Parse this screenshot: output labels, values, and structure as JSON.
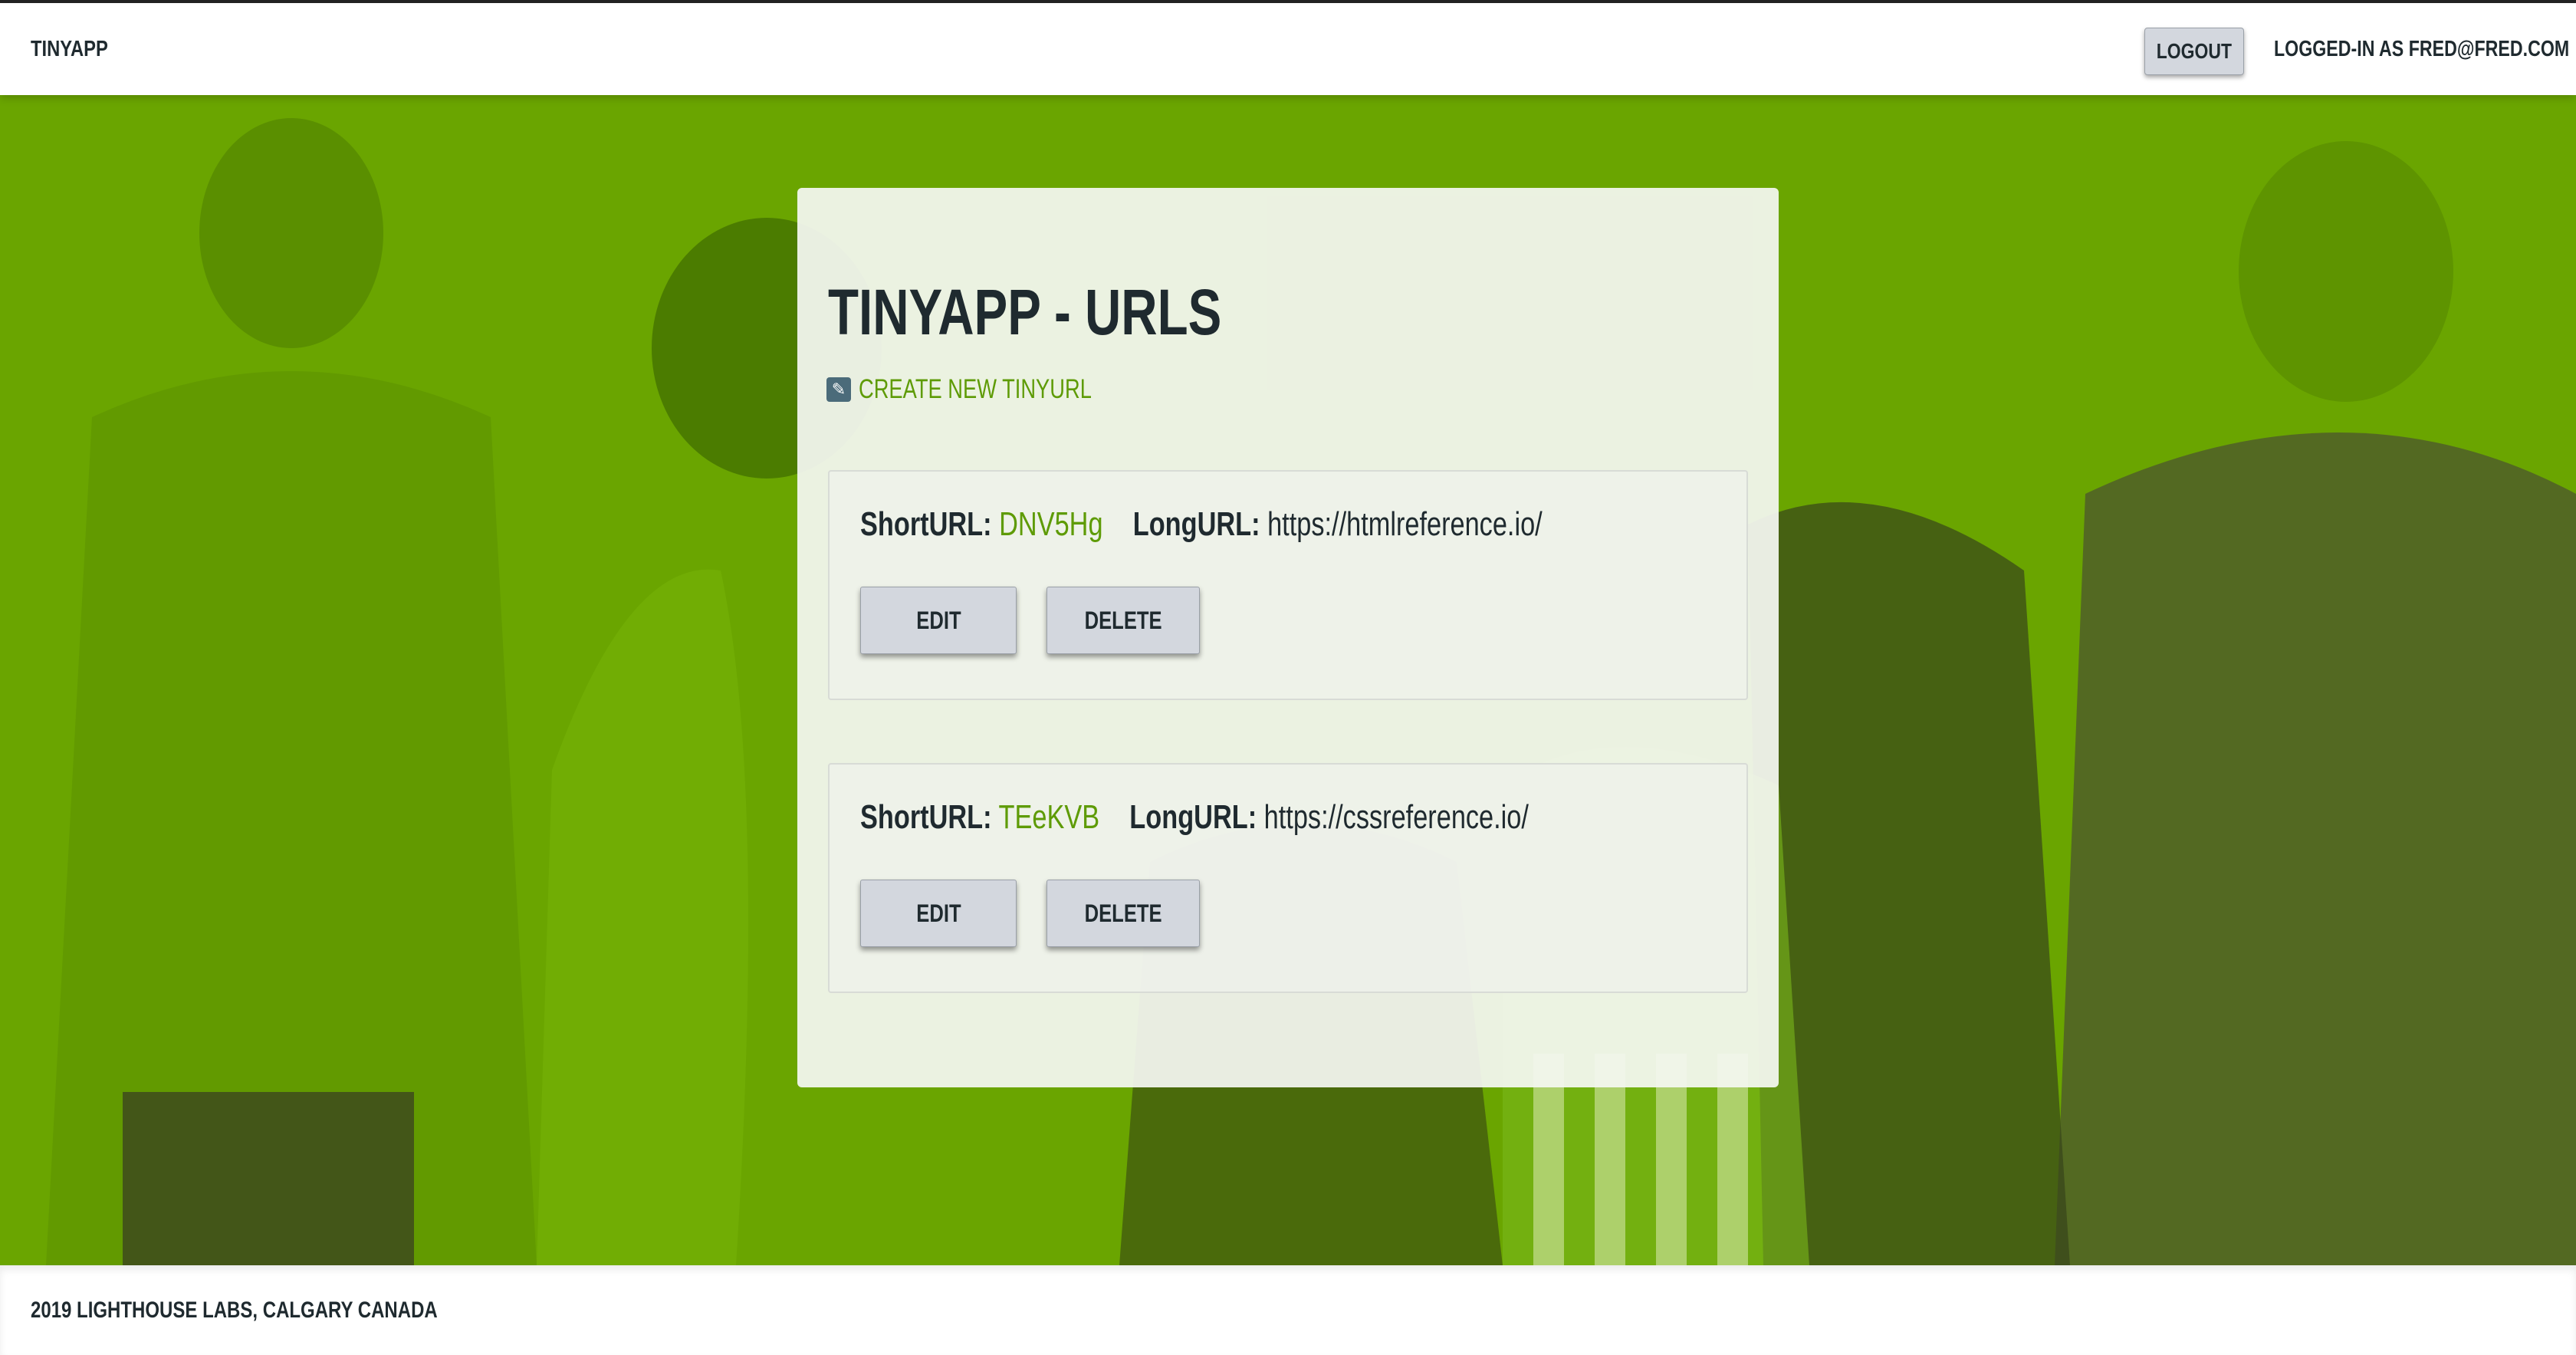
{
  "header": {
    "brand": "TINYAPP",
    "logout_label": "LOGOUT",
    "logged_in_text": "LOGGED-IN AS FRED@FRED.COM"
  },
  "main": {
    "title": "TINYAPP - URLS",
    "create_link": "CREATE NEW TINYURL",
    "short_label": "ShortURL:",
    "long_label": "LongURL:",
    "edit_label": "EDIT",
    "delete_label": "DELETE",
    "urls": [
      {
        "short": "DNV5Hg",
        "long": "https://htmlreference.io/"
      },
      {
        "short": "TEeKVB",
        "long": "https://cssreference.io/"
      }
    ]
  },
  "footer": {
    "text": "2019 LIGHTHOUSE LABS, CALGARY CANADA"
  },
  "colors": {
    "hero_green": "#6aa500",
    "link_green": "#5e9b06",
    "text_dark": "#1f2a2f",
    "button_grey": "#d3d7de"
  },
  "icons": {
    "create": "edit-pencil-icon"
  }
}
